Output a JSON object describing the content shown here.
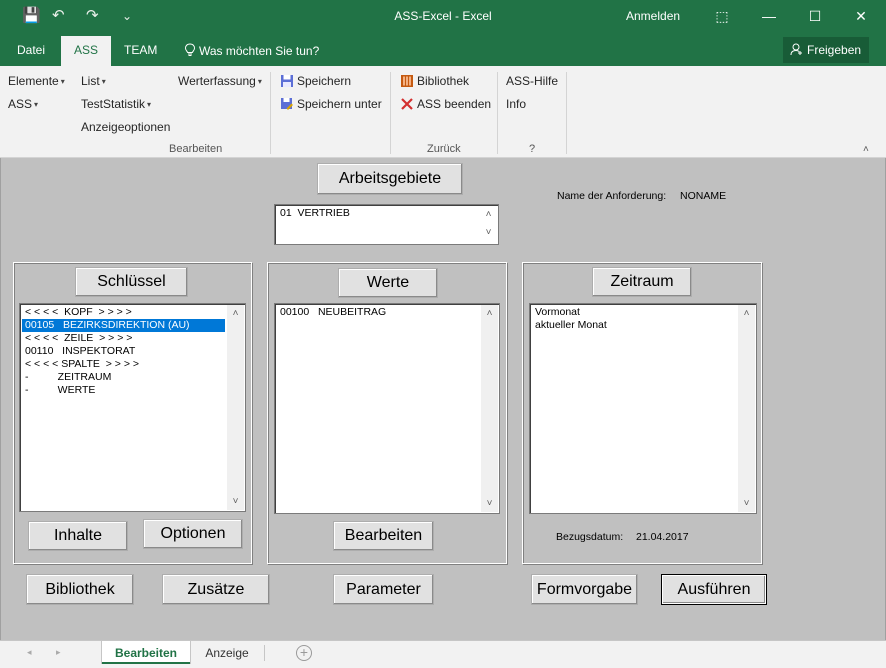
{
  "window": {
    "title": "ASS-Excel  -  Excel",
    "signin": "Anmelden",
    "quick_access": {
      "save": "💾",
      "undo": "↶",
      "redo": "↷",
      "customize": "⌄"
    },
    "controls": {
      "ribbon_display": "⬚",
      "minimize": "—",
      "maximize": "☐",
      "close": "✕"
    }
  },
  "ribbon_tabs": [
    "Datei",
    "ASS",
    "TEAM"
  ],
  "tell_me": "Was möchten Sie tun?",
  "share": "Freigeben",
  "ribbon": {
    "g1": {
      "elemente": "Elemente",
      "ass": "ASS",
      "list": "List",
      "teststatistik": "TestStatistik",
      "anzeigeoptionen": "Anzeigeoptionen",
      "werterfassung": "Werterfassung",
      "label": "Bearbeiten"
    },
    "g2": {
      "speichern": "Speichern",
      "speichern_unter": "Speichern unter"
    },
    "g3": {
      "bibliothek": "Bibliothek",
      "ass_beenden": "ASS beenden",
      "label": "Zurück"
    },
    "g4": {
      "ass_hilfe": "ASS-Hilfe",
      "info": "Info",
      "label": "?"
    },
    "dropdown_arrow": "▾",
    "collapse": "˄"
  },
  "form": {
    "arbeitsgebiete_button": "Arbeitsgebiete",
    "anforderung_label": "Name der Anforderung:",
    "anforderung_value": "NONAME",
    "arbeitsgebiete_list": [
      "01  VERTRIEB"
    ],
    "schluessel_button": "Schlüssel",
    "schluessel_list": [
      "< < < <  KOPF  > > > >",
      "00105   BEZIRKSDIREKTION (AU)",
      "< < < <  ZEILE  > > > >",
      "00110   INSPEKTORAT",
      "< < < < SPALTE  > > > >",
      "-          ZEITRAUM",
      "-          WERTE"
    ],
    "werte_button": "Werte",
    "werte_list": [
      "00100   NEUBEITRAG"
    ],
    "zeitraum_button": "Zeitraum",
    "zeitraum_list": [
      "Vormonat",
      "aktueller Monat"
    ],
    "inhalte_button": "Inhalte",
    "optionen_button": "Optionen",
    "bearbeiten_button": "Bearbeiten",
    "bezugsdatum_label": "Bezugsdatum:",
    "bezugsdatum_value": "21.04.2017",
    "bibliothek_button": "Bibliothek",
    "zusaetze_button": "Zusätze",
    "parameter_button": "Parameter",
    "formvorgabe_button": "Formvorgabe",
    "ausfuehren_button": "Ausführen",
    "scroll_up": "˄",
    "scroll_down": "˅"
  },
  "sheets": {
    "active": "Bearbeiten",
    "other": "Anzeige",
    "add": "+",
    "nav_prev": "◂",
    "nav_next": "▸"
  },
  "colors": {
    "excel_green": "#217346",
    "selection": "#0078d7",
    "form_gray": "#c0c0c0"
  }
}
